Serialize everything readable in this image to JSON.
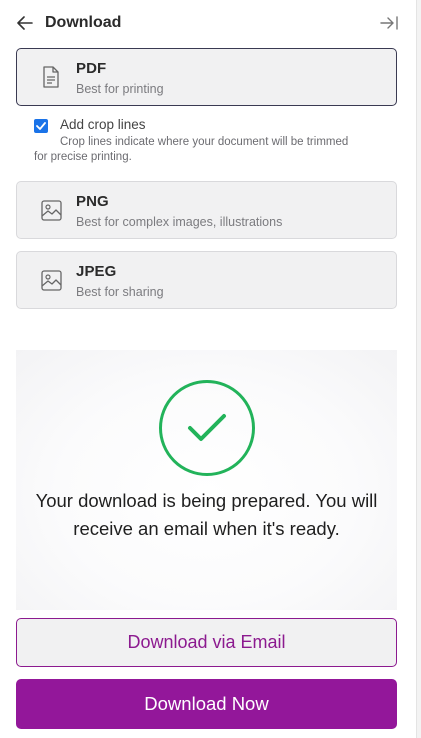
{
  "header": {
    "title": "Download"
  },
  "formats": [
    {
      "name": "PDF",
      "description": "Best for printing",
      "icon": "document-icon",
      "selected": true
    },
    {
      "name": "PNG",
      "description": "Best for complex images, illustrations",
      "icon": "image-icon",
      "selected": false
    },
    {
      "name": "JPEG",
      "description": "Best for sharing",
      "icon": "image-icon",
      "selected": false
    }
  ],
  "crop_lines": {
    "label": "Add crop lines",
    "help_line1": "Crop lines indicate where your document will be trimmed",
    "help_line2": "for precise printing.",
    "checked": true
  },
  "status": {
    "message_line1": "Your download is being prepared. You will",
    "message_line2": "receive an email when it's ready.",
    "icon": "check-circle-icon",
    "color": "#22b35a"
  },
  "actions": {
    "email_label": "Download via Email",
    "now_label": "Download Now",
    "accent_color": "#93179a"
  }
}
